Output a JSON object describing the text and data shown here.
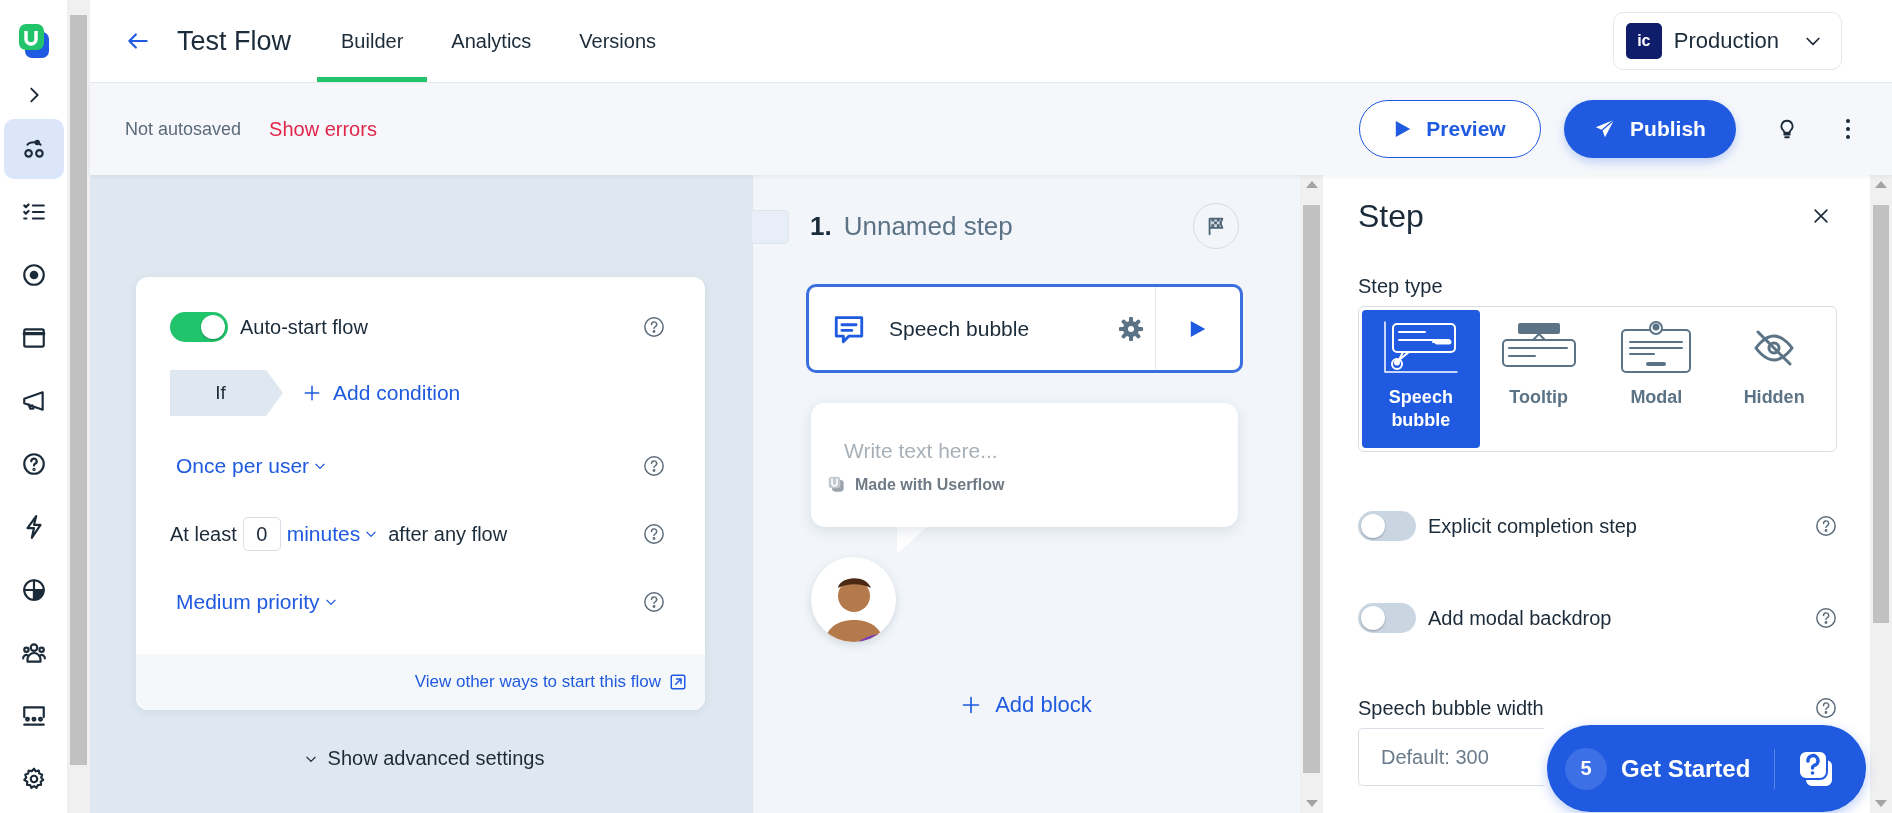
{
  "header": {
    "title": "Test Flow",
    "tabs": [
      {
        "label": "Builder",
        "selected": true
      },
      {
        "label": "Analytics",
        "selected": false
      },
      {
        "label": "Versions",
        "selected": false
      }
    ],
    "environment": {
      "badge": "ic",
      "label": "Production"
    }
  },
  "toolbar": {
    "save_status": "Not autosaved",
    "errors_link": "Show errors",
    "preview": "Preview",
    "publish": "Publish"
  },
  "nav": {
    "items": [
      {
        "selected": true
      },
      {
        "selected": false
      },
      {
        "selected": false
      },
      {
        "selected": false
      },
      {
        "selected": false
      },
      {
        "selected": false
      },
      {
        "selected": false
      },
      {
        "selected": false
      },
      {
        "selected": false
      },
      {
        "selected": false
      },
      {
        "selected": false
      }
    ]
  },
  "start_settings": {
    "auto_start": {
      "label": "Auto-start flow",
      "on": true
    },
    "condition_prefix": "If",
    "add_condition": "Add condition",
    "frequency": "Once per user",
    "delay": {
      "prefix": "At least",
      "value": "0",
      "unit": "minutes",
      "suffix": "after any flow"
    },
    "priority": "Medium priority",
    "footer_link": "View other ways to start this flow",
    "advanced": "Show advanced settings"
  },
  "step": {
    "number": "1.",
    "name": "Unnamed step",
    "block": {
      "label": "Speech bubble"
    },
    "bubble": {
      "placeholder": "Write text here...",
      "branding": "Made with Userflow"
    },
    "add_block": "Add block"
  },
  "panel": {
    "title": "Step",
    "type_label": "Step type",
    "types": [
      {
        "label": "Speech bubble",
        "selected": true
      },
      {
        "label": "Tooltip",
        "selected": false
      },
      {
        "label": "Modal",
        "selected": false
      },
      {
        "label": "Hidden",
        "selected": false
      }
    ],
    "toggles": [
      {
        "label": "Explicit completion step",
        "on": false
      },
      {
        "label": "Add modal backdrop",
        "on": false
      }
    ],
    "width": {
      "label": "Speech bubble width",
      "placeholder": "Default: 300"
    }
  },
  "launcher": {
    "count": "5",
    "label": "Get Started"
  }
}
